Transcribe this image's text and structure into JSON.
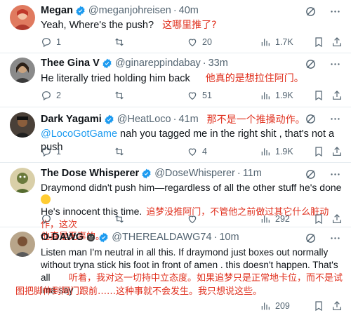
{
  "tweets": [
    {
      "name": "Megan",
      "handle": "@meganjohreisen",
      "time": "40m",
      "text": "Yeah, Where's the push?",
      "annotation": "这哪里推了?",
      "replies": "1",
      "retweets": "",
      "likes": "20",
      "views": "1.7K"
    },
    {
      "name": "Thee Gina V",
      "handle": "@ginareppindabay",
      "time": "33m",
      "text": "He literally tried holding him back",
      "annotation": "他真的是想拉住阿门。",
      "replies": "2",
      "retweets": "",
      "likes": "51",
      "views": "1.9K"
    },
    {
      "name": "Dark Yagami",
      "handle": "@HeatLoco",
      "time": "41m",
      "annotation": "那不是一个推搡动作。",
      "mention": "@LocoGotGame",
      "text": " nah you tagged me in the right shit , that's not a push",
      "replies": "1",
      "retweets": "",
      "likes": "4",
      "views": "1.9K"
    },
    {
      "name": "The Dose Whisperer",
      "handle": "@DoseWhisperer",
      "time": "11m",
      "text_line1": "Draymond didn't push him—regardless of all the other stuff he's done",
      "text_line2": "He's innocent this time.",
      "annotation1": "追梦没推阿门，不管他之前做过其它什么脏动作，这次",
      "annotation2": "他真是无辜的。",
      "replies": "",
      "retweets": "",
      "likes": "",
      "views": "292"
    },
    {
      "name": "O-DAWG",
      "handle": "@THEREALDAWG74",
      "time": "10m",
      "text_line1": "Listen man I'm neutral in all this. If draymond just boxes out normally",
      "text_line2": "without tryna stick his foot in front of amen . this doesn't happen. That's all",
      "text_line3_a": "ima say",
      "annotation1": "听着，我对这一切持中立态度。如果追梦只是正常地卡位，而不是试",
      "annotation2": "图把脚伸到阿门跟前……这种事就不会发生。我只想说这些。",
      "replies": "",
      "retweets": "",
      "likes": "",
      "views": "209"
    }
  ],
  "colors": {
    "verified": "#1d9bf0",
    "annotation": "#e0301e",
    "muted": "#536471",
    "link": "#1d9bf0"
  },
  "icons": [
    "reply-icon",
    "retweet-icon",
    "like-icon",
    "views-icon",
    "grok-icon",
    "more-icon",
    "verified-icon",
    "bookmark-icon",
    "share-icon"
  ]
}
